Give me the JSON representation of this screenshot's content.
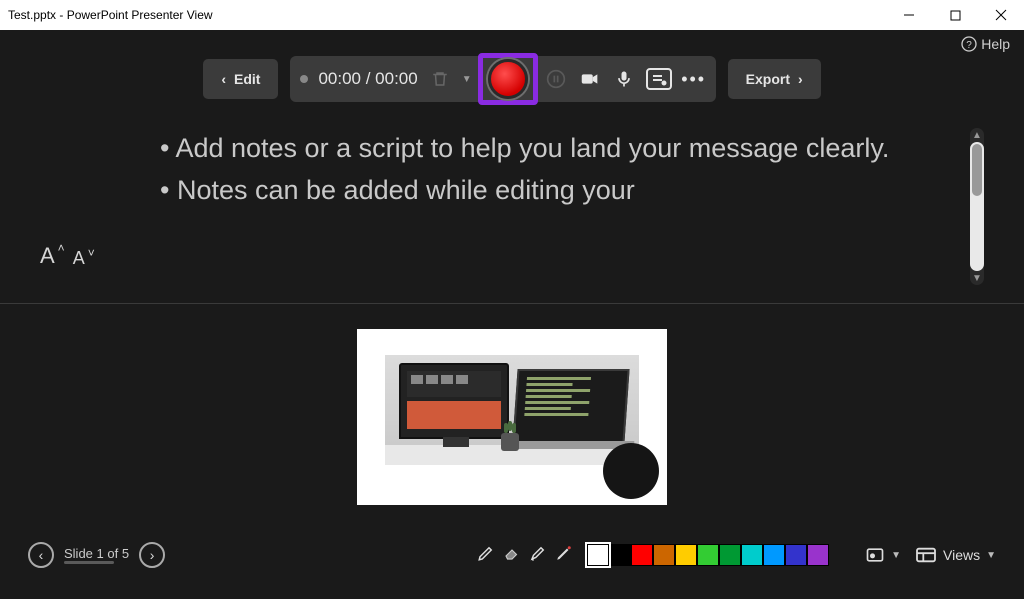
{
  "window": {
    "title": "Test.pptx - PowerPoint Presenter View"
  },
  "help": {
    "label": "Help"
  },
  "toolbar": {
    "edit_label": "Edit",
    "time_text": "00:00 / 00:00",
    "export_label": "Export"
  },
  "notes": {
    "line1": "• Add notes or a script to help you land your message clearly.",
    "line2": "• Notes can be added while editing your"
  },
  "footer": {
    "slide_indicator": "Slide 1 of 5",
    "views_label": "Views",
    "colors": [
      "#ffffff",
      "#000000",
      "#ff0000",
      "#cc6600",
      "#ffcc00",
      "#33cc33",
      "#009933",
      "#00cccc",
      "#0099ff",
      "#3333cc",
      "#9933cc"
    ]
  }
}
